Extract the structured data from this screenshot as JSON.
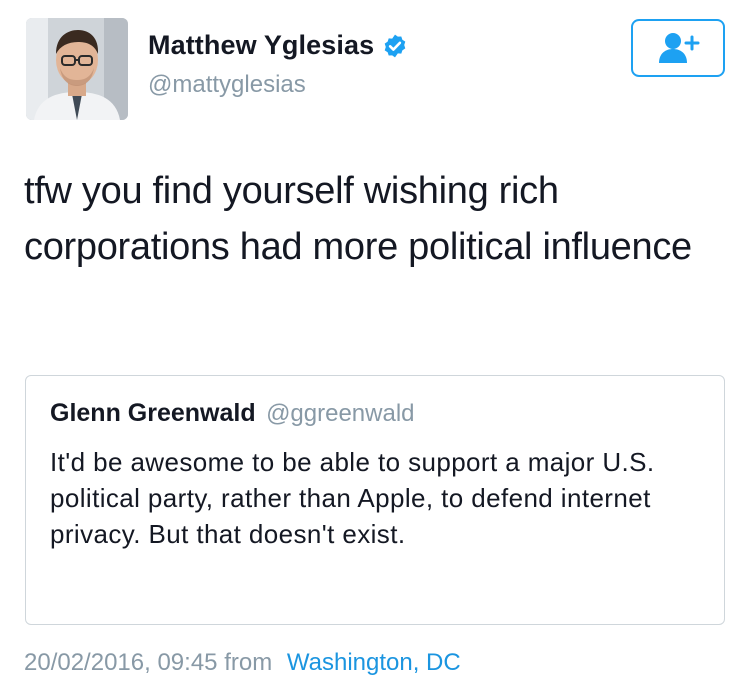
{
  "author": {
    "name": "Matthew Yglesias",
    "handle": "@mattyglesias",
    "verified": true
  },
  "follow_button": {
    "icon": "add-user-icon"
  },
  "tweet": {
    "text": "tfw you find yourself wishing rich corporations had more political influence"
  },
  "quoted_tweet": {
    "author_name": "Glenn Greenwald",
    "author_handle": "@ggreenwald",
    "text": "It'd be awesome to be able to support a major U.S. political party, rather than Apple, to defend internet privacy. But that doesn't exist."
  },
  "meta": {
    "timestamp": "20/02/2016, 09:45",
    "from_label": "from",
    "location": "Washington, DC"
  },
  "colors": {
    "accent": "#1da1f2",
    "secondary_text": "#8899a6",
    "link": "#1b95e0",
    "border": "#cfd6db"
  }
}
